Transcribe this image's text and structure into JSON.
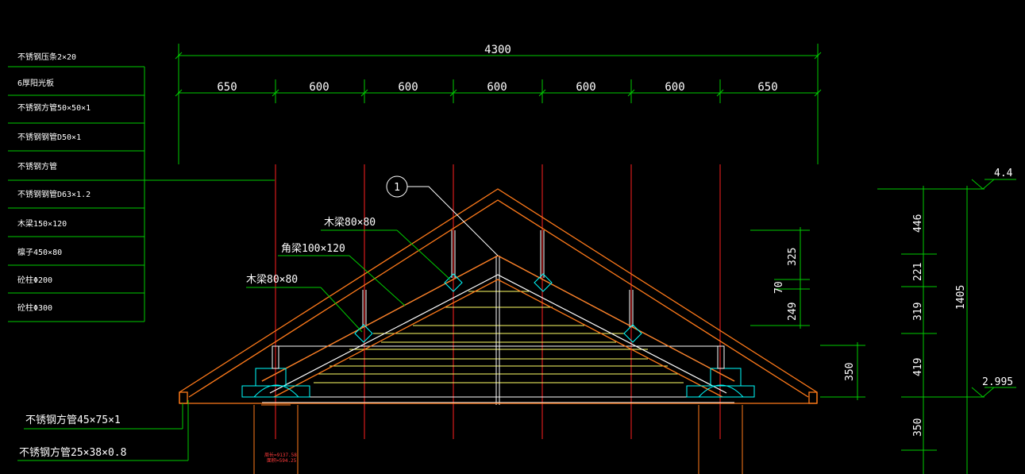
{
  "colors": {
    "background": "#000000",
    "dimension": "#00cc00",
    "roof": "#ff7a1a",
    "axis": "#ff2020",
    "purlin": "#ffff66",
    "member": "#ffffff",
    "block": "#00ffff",
    "text": "#ffffff"
  },
  "dimensions": {
    "overall": "4300",
    "segments": [
      "650",
      "600",
      "600",
      "600",
      "600",
      "600",
      "650"
    ]
  },
  "legend": [
    "不锈钢压条2×20",
    "6厚阳光板",
    "不锈钢方管50×50×1",
    "不锈钢钢管D50×1",
    "不锈钢方管",
    "不锈钢钢管D63×1.2",
    "木梁150×120",
    "檩子450×80",
    "砼柱Φ200",
    "砼柱Φ300"
  ],
  "callouts": {
    "detail_number": "1",
    "beam_top": "木梁80×80",
    "corner_beam": "角梁100×120",
    "beam_left": "木梁80×80",
    "tube_45": "不锈钢方管45×75×1",
    "tube_25": "不锈钢方管25×38×0.8",
    "area_note_1": "周长=9137.58",
    "area_note_2": "面积=594.25"
  },
  "right_dims": {
    "d325": "325",
    "d70": "70",
    "d249": "249",
    "d350_mid": "350",
    "d446": "446",
    "d221": "221",
    "d319": "319",
    "d419": "419",
    "d350_low": "350",
    "d1405": "1405"
  },
  "elevations": {
    "top": "4.4",
    "eave": "2.995"
  }
}
